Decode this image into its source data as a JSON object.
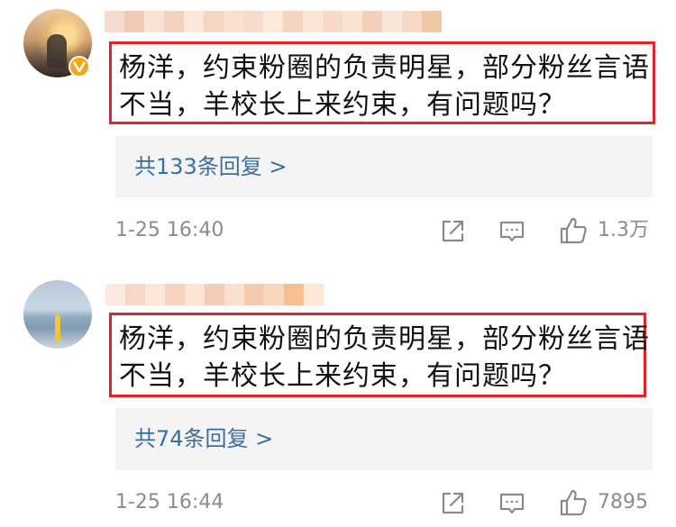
{
  "comments": [
    {
      "text_line1": "杨洋，约束粉圈的负责明星，部分粉丝言语",
      "text_line2": "不当，羊校长上来约束，有问题吗？",
      "replies_link": "共133条回复 >",
      "time": "1-25 16:40",
      "like_count": "1.3万",
      "avatar_icon": "user-avatar",
      "verified_icon": "verified-badge-icon",
      "blur_colors": [
        "#f6dcd0",
        "#f2c9b6",
        "#f9e2d4",
        "#f3d1c0",
        "#fbe6d9",
        "#f5d6c3",
        "#f9e0d1",
        "#f6dccd",
        "#fbe9dc",
        "#f4d3c0",
        "#fbe5d6",
        "#f6d9c7",
        "#f9e3d3",
        "#f3cfb9",
        "#f9e6d8",
        "#f5d9c8",
        "#f0c7a2"
      ]
    },
    {
      "text_line1": "杨洋，约束粉圈的负责明星，部分粉丝言语",
      "text_line2": "不当，羊校长上来约束，有问题吗？",
      "replies_link": "共74条回复 >",
      "time": "1-25 16:44",
      "like_count": "7895",
      "avatar_icon": "user-avatar",
      "blur_colors": [
        "#fbeae2",
        "#f6d8cb",
        "#fce6da",
        "#f7d2bf",
        "#fbe3d5",
        "#f4cbb6",
        "#fae0cf",
        "#f5c9ad",
        "#f9d7bd",
        "#f6c093",
        "#fde8d8"
      ]
    }
  ],
  "icons": {
    "share": "share-icon",
    "reply": "comment-icon",
    "like": "thumbs-up-icon"
  },
  "colors": {
    "highlight_border": "#e0242a",
    "link": "#3b6ea0",
    "meta_text": "#8c8c8c",
    "reply_bg": "#f4f4f4",
    "verified": "#f7a51c"
  }
}
